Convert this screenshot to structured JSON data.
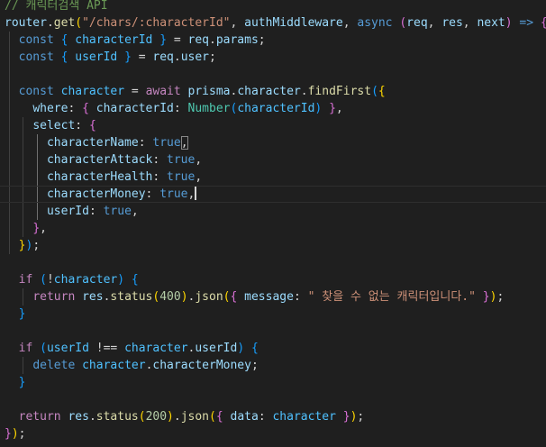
{
  "colors": {
    "background": "#1f1f1f",
    "comment": "#6a9955",
    "keyword": "#569cd6",
    "control": "#c586c0",
    "variable": "#9cdcfe",
    "constant": "#4fc1ff",
    "function": "#dcdcaa",
    "string": "#ce9178",
    "number": "#b5cea8",
    "type": "#4ec9b0",
    "plain": "#d4d4d4",
    "bracket1": "#ffd700",
    "bracket2": "#da70d6",
    "bracket3": "#179fff"
  },
  "lines": [
    [
      [
        "// 캐릭터검색 API",
        "comment"
      ]
    ],
    [
      [
        "router",
        "variable"
      ],
      [
        ".",
        "plain"
      ],
      [
        "get",
        "function"
      ],
      [
        "(",
        "bracket1"
      ],
      [
        "\"/chars/:characterId\"",
        "string"
      ],
      [
        ", ",
        "plain"
      ],
      [
        "authMiddleware",
        "variable"
      ],
      [
        ", ",
        "plain"
      ],
      [
        "async",
        "keyword"
      ],
      [
        " ",
        "plain"
      ],
      [
        "(",
        "bracket2"
      ],
      [
        "req",
        "variable"
      ],
      [
        ", ",
        "plain"
      ],
      [
        "res",
        "variable"
      ],
      [
        ", ",
        "plain"
      ],
      [
        "next",
        "variable"
      ],
      [
        ")",
        "bracket2"
      ],
      [
        " ",
        "plain"
      ],
      [
        "=>",
        "keyword"
      ],
      [
        " ",
        "plain"
      ],
      [
        "{",
        "bracket2"
      ]
    ],
    [
      [
        "  ",
        "plain"
      ],
      [
        "const",
        "keyword"
      ],
      [
        " ",
        "plain"
      ],
      [
        "{",
        "bracket3"
      ],
      [
        " ",
        "plain"
      ],
      [
        "characterId",
        "constant"
      ],
      [
        " ",
        "plain"
      ],
      [
        "}",
        "bracket3"
      ],
      [
        " = ",
        "plain"
      ],
      [
        "req",
        "variable"
      ],
      [
        ".",
        "plain"
      ],
      [
        "params",
        "variable"
      ],
      [
        ";",
        "plain"
      ]
    ],
    [
      [
        "  ",
        "plain"
      ],
      [
        "const",
        "keyword"
      ],
      [
        " ",
        "plain"
      ],
      [
        "{",
        "bracket3"
      ],
      [
        " ",
        "plain"
      ],
      [
        "userId",
        "constant"
      ],
      [
        " ",
        "plain"
      ],
      [
        "}",
        "bracket3"
      ],
      [
        " = ",
        "plain"
      ],
      [
        "req",
        "variable"
      ],
      [
        ".",
        "plain"
      ],
      [
        "user",
        "variable"
      ],
      [
        ";",
        "plain"
      ]
    ],
    [],
    [
      [
        "  ",
        "plain"
      ],
      [
        "const",
        "keyword"
      ],
      [
        " ",
        "plain"
      ],
      [
        "character",
        "constant"
      ],
      [
        " = ",
        "plain"
      ],
      [
        "await",
        "control"
      ],
      [
        " ",
        "plain"
      ],
      [
        "prisma",
        "variable"
      ],
      [
        ".",
        "plain"
      ],
      [
        "character",
        "variable"
      ],
      [
        ".",
        "plain"
      ],
      [
        "findFirst",
        "function"
      ],
      [
        "(",
        "bracket3"
      ],
      [
        "{",
        "bracket1"
      ]
    ],
    [
      [
        "    ",
        "plain"
      ],
      [
        "where",
        "variable"
      ],
      [
        ": ",
        "plain"
      ],
      [
        "{",
        "bracket2"
      ],
      [
        " ",
        "plain"
      ],
      [
        "characterId",
        "variable"
      ],
      [
        ": ",
        "plain"
      ],
      [
        "Number",
        "type"
      ],
      [
        "(",
        "bracket3"
      ],
      [
        "characterId",
        "constant"
      ],
      [
        ")",
        "bracket3"
      ],
      [
        " ",
        "plain"
      ],
      [
        "}",
        "bracket2"
      ],
      [
        ",",
        "plain"
      ]
    ],
    [
      [
        "    ",
        "plain"
      ],
      [
        "select",
        "variable"
      ],
      [
        ": ",
        "plain"
      ],
      [
        "{",
        "bracket2"
      ]
    ],
    [
      [
        "      ",
        "plain"
      ],
      [
        "characterName",
        "variable"
      ],
      [
        ": ",
        "plain"
      ],
      [
        "true",
        "keyword"
      ],
      [
        ",",
        "plain"
      ]
    ],
    [
      [
        "      ",
        "plain"
      ],
      [
        "characterAttack",
        "variable"
      ],
      [
        ": ",
        "plain"
      ],
      [
        "true",
        "keyword"
      ],
      [
        ",",
        "plain"
      ]
    ],
    [
      [
        "      ",
        "plain"
      ],
      [
        "characterHealth",
        "variable"
      ],
      [
        ": ",
        "plain"
      ],
      [
        "true",
        "keyword"
      ],
      [
        ",",
        "plain"
      ]
    ],
    [
      [
        "      ",
        "plain"
      ],
      [
        "characterMoney",
        "variable"
      ],
      [
        ": ",
        "plain"
      ],
      [
        "true",
        "keyword"
      ],
      [
        ",",
        "plain"
      ]
    ],
    [
      [
        "      ",
        "plain"
      ],
      [
        "userId",
        "variable"
      ],
      [
        ": ",
        "plain"
      ],
      [
        "true",
        "keyword"
      ],
      [
        ",",
        "plain"
      ]
    ],
    [
      [
        "    ",
        "plain"
      ],
      [
        "}",
        "bracket2"
      ],
      [
        ",",
        "plain"
      ]
    ],
    [
      [
        "  ",
        "plain"
      ],
      [
        "}",
        "bracket1"
      ],
      [
        ")",
        "bracket3"
      ],
      [
        ";",
        "plain"
      ]
    ],
    [],
    [
      [
        "  ",
        "plain"
      ],
      [
        "if",
        "control"
      ],
      [
        " ",
        "plain"
      ],
      [
        "(",
        "bracket3"
      ],
      [
        "!",
        "plain"
      ],
      [
        "character",
        "constant"
      ],
      [
        ")",
        "bracket3"
      ],
      [
        " ",
        "plain"
      ],
      [
        "{",
        "bracket3"
      ]
    ],
    [
      [
        "    ",
        "plain"
      ],
      [
        "return",
        "control"
      ],
      [
        " ",
        "plain"
      ],
      [
        "res",
        "variable"
      ],
      [
        ".",
        "plain"
      ],
      [
        "status",
        "function"
      ],
      [
        "(",
        "bracket1"
      ],
      [
        "400",
        "number"
      ],
      [
        ")",
        "bracket1"
      ],
      [
        ".",
        "plain"
      ],
      [
        "json",
        "function"
      ],
      [
        "(",
        "bracket1"
      ],
      [
        "{",
        "bracket2"
      ],
      [
        " ",
        "plain"
      ],
      [
        "message",
        "variable"
      ],
      [
        ": ",
        "plain"
      ],
      [
        "\" 찾을 수 없는 캐릭터입니다.\"",
        "string"
      ],
      [
        " ",
        "plain"
      ],
      [
        "}",
        "bracket2"
      ],
      [
        ")",
        "bracket1"
      ],
      [
        ";",
        "plain"
      ]
    ],
    [
      [
        "  ",
        "plain"
      ],
      [
        "}",
        "bracket3"
      ]
    ],
    [],
    [
      [
        "  ",
        "plain"
      ],
      [
        "if",
        "control"
      ],
      [
        " ",
        "plain"
      ],
      [
        "(",
        "bracket3"
      ],
      [
        "userId",
        "constant"
      ],
      [
        " !== ",
        "plain"
      ],
      [
        "character",
        "constant"
      ],
      [
        ".",
        "plain"
      ],
      [
        "userId",
        "variable"
      ],
      [
        ")",
        "bracket3"
      ],
      [
        " ",
        "plain"
      ],
      [
        "{",
        "bracket3"
      ]
    ],
    [
      [
        "    ",
        "plain"
      ],
      [
        "delete",
        "keyword"
      ],
      [
        " ",
        "plain"
      ],
      [
        "character",
        "constant"
      ],
      [
        ".",
        "plain"
      ],
      [
        "characterMoney",
        "variable"
      ],
      [
        ";",
        "plain"
      ]
    ],
    [
      [
        "  ",
        "plain"
      ],
      [
        "}",
        "bracket3"
      ]
    ],
    [],
    [
      [
        "  ",
        "plain"
      ],
      [
        "return",
        "control"
      ],
      [
        " ",
        "plain"
      ],
      [
        "res",
        "variable"
      ],
      [
        ".",
        "plain"
      ],
      [
        "status",
        "function"
      ],
      [
        "(",
        "bracket1"
      ],
      [
        "200",
        "number"
      ],
      [
        ")",
        "bracket1"
      ],
      [
        ".",
        "plain"
      ],
      [
        "json",
        "function"
      ],
      [
        "(",
        "bracket1"
      ],
      [
        "{",
        "bracket2"
      ],
      [
        " ",
        "plain"
      ],
      [
        "data",
        "variable"
      ],
      [
        ": ",
        "plain"
      ],
      [
        "character",
        "constant"
      ],
      [
        " ",
        "plain"
      ],
      [
        "}",
        "bracket2"
      ],
      [
        ")",
        "bracket1"
      ],
      [
        ";",
        "plain"
      ]
    ],
    [
      [
        "}",
        "bracket2"
      ],
      [
        ")",
        "bracket1"
      ],
      [
        ";",
        "plain"
      ]
    ]
  ],
  "current_line": 12,
  "cursor_after_token": 5,
  "matched_brackets": [
    [
      8,
      4
    ],
    [
      14,
      5
    ]
  ]
}
